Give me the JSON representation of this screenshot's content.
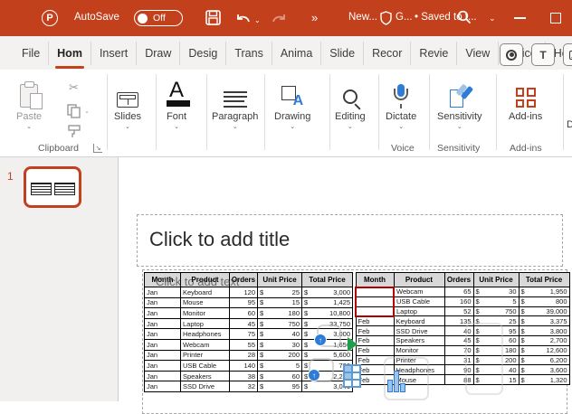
{
  "titlebar": {
    "app_logo": "P",
    "autosave_label": "AutoSave",
    "autosave_state": "Off",
    "more_commands": "»",
    "doc_title": "New...",
    "guard_label": "G...",
    "saved_status": "• Saved to t...",
    "accent_color": "#C2411C"
  },
  "tabs": {
    "items": [
      "File",
      "Hom",
      "Insert",
      "Draw",
      "Desig",
      "Trans",
      "Anima",
      "Slide",
      "Recor",
      "Revie",
      "View",
      "Office",
      "Help"
    ],
    "active_index": 1
  },
  "ribbon": {
    "paste_label": "Paste",
    "slides_label": "Slides",
    "font_label": "Font",
    "paragraph_label": "Paragraph",
    "drawing_label": "Drawing",
    "editing_label": "Editing",
    "dictate_label": "Dictate",
    "sensitivity_label": "Sensitivity",
    "addins_label": "Add-ins",
    "clipboard_group": "Clipboard",
    "voice_group": "Voice",
    "sensitivity_group": "Sensitivity",
    "addins_group": "Add-ins",
    "cutoff_button": "D"
  },
  "thumbnails": {
    "slide_number": "1"
  },
  "slide": {
    "title_placeholder": "Click to add title",
    "content_ghost": "Click to add text"
  },
  "tables": {
    "currency": "$",
    "headers": [
      "Month",
      "Product",
      "Orders",
      "Unit Price",
      "Total Price"
    ],
    "left": {
      "rows": [
        [
          "Jan",
          "Keyboard",
          "120",
          "25",
          "3,000"
        ],
        [
          "Jan",
          "Mouse",
          "95",
          "15",
          "1,425"
        ],
        [
          "Jan",
          "Monitor",
          "60",
          "180",
          "10,800"
        ],
        [
          "Jan",
          "Laptop",
          "45",
          "750",
          "33,750"
        ],
        [
          "Jan",
          "Headphones",
          "75",
          "40",
          "3,000"
        ],
        [
          "Jan",
          "Webcam",
          "55",
          "30",
          "1,650"
        ],
        [
          "Jan",
          "Printer",
          "28",
          "200",
          "5,600"
        ],
        [
          "Jan",
          "USB Cable",
          "140",
          "5",
          "700"
        ],
        [
          "Jan",
          "Speakers",
          "38",
          "60",
          "2,280"
        ],
        [
          "Jan",
          "SSD Drive",
          "32",
          "95",
          "3,040"
        ]
      ]
    },
    "right": {
      "rows": [
        [
          "",
          "Webcam",
          "65",
          "30",
          "1,950"
        ],
        [
          "",
          "USB Cable",
          "160",
          "5",
          "800"
        ],
        [
          "",
          "Laptop",
          "52",
          "750",
          "39,000"
        ],
        [
          "Feb",
          "Keyboard",
          "135",
          "25",
          "3,375"
        ],
        [
          "Feb",
          "SSD Drive",
          "40",
          "95",
          "3,800"
        ],
        [
          "Feb",
          "Speakers",
          "45",
          "60",
          "2,700"
        ],
        [
          "Feb",
          "Monitor",
          "70",
          "180",
          "12,600"
        ],
        [
          "Feb",
          "Printer",
          "31",
          "200",
          "6,200"
        ],
        [
          "Feb",
          "Headphones",
          "90",
          "40",
          "3,600"
        ],
        [
          "Feb",
          "Mouse",
          "88",
          "15",
          "1,320"
        ]
      ],
      "red_selection_rows": [
        0,
        1,
        2
      ],
      "red_selection_color": "#B00000"
    }
  }
}
